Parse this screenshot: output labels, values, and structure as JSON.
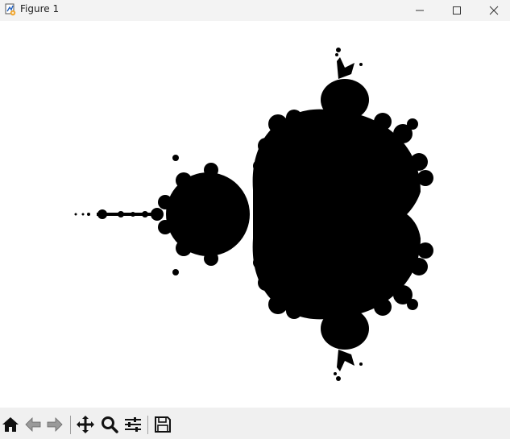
{
  "window": {
    "title": "Figure 1",
    "app_icon": "matplotlib-figure-icon",
    "controls": [
      "minimize-icon",
      "maximize-icon",
      "close-icon"
    ]
  },
  "figure": {
    "content": "mandelbrot-set",
    "fill_color": "#000000",
    "background_color": "#ffffff"
  },
  "toolbar": {
    "buttons": [
      {
        "icon": "home-icon",
        "enabled": true
      },
      {
        "icon": "back-arrow-icon",
        "enabled": false
      },
      {
        "icon": "forward-arrow-icon",
        "enabled": false
      },
      {
        "icon": "pan-move-icon",
        "enabled": true
      },
      {
        "icon": "zoom-magnifier-icon",
        "enabled": true
      },
      {
        "icon": "configure-subplots-icon",
        "enabled": true
      },
      {
        "icon": "save-floppy-icon",
        "enabled": true
      }
    ]
  }
}
